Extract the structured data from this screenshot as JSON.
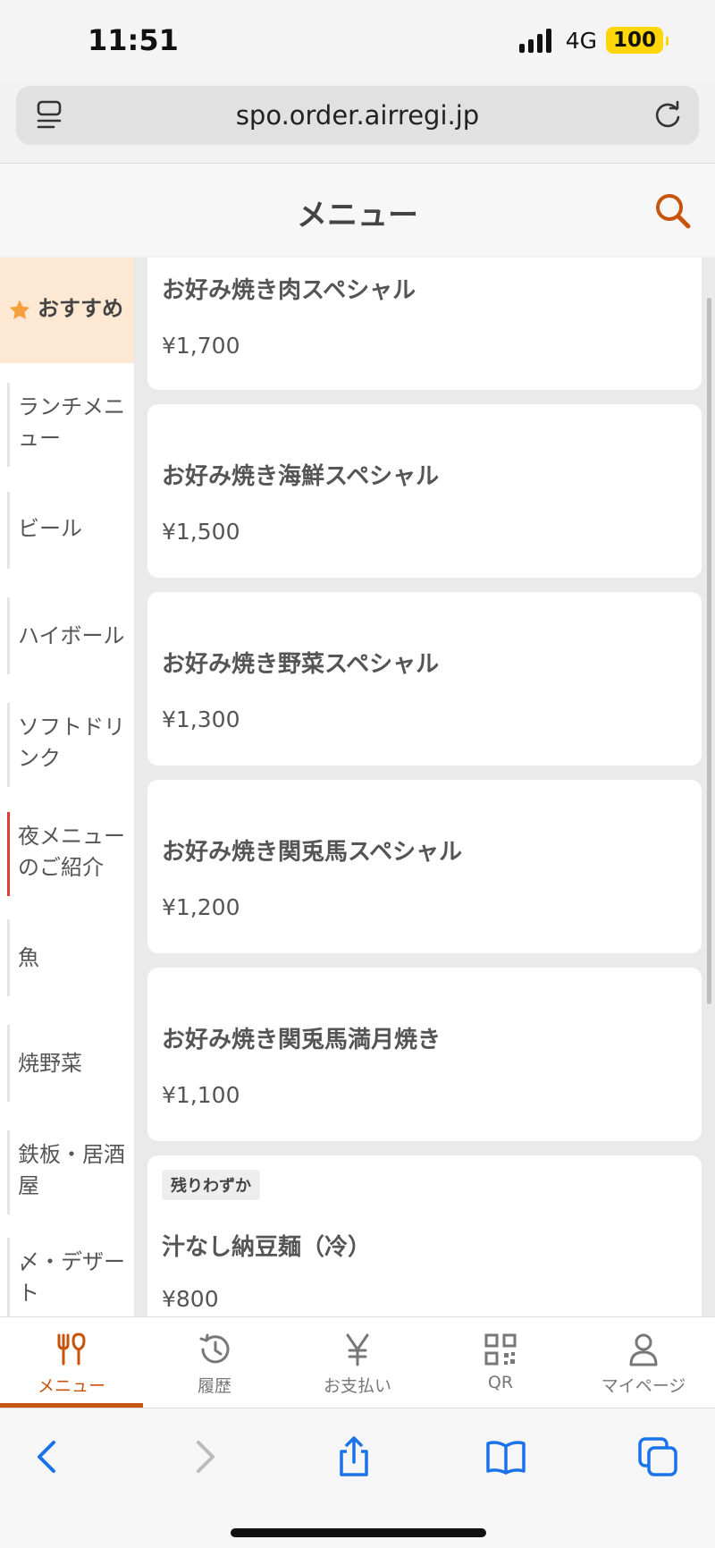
{
  "status_bar": {
    "time": "11:51",
    "network": "4G",
    "battery": "100"
  },
  "browser": {
    "url": "spo.order.airregi.jp"
  },
  "header": {
    "title": "メニュー"
  },
  "sidebar": {
    "items": [
      {
        "label": "おすすめ"
      },
      {
        "label": "ランチメニュー"
      },
      {
        "label": "ビール"
      },
      {
        "label": "ハイボール"
      },
      {
        "label": "ソフトドリンク"
      },
      {
        "label": "夜メニューのご紹介"
      },
      {
        "label": "魚"
      },
      {
        "label": "焼野菜"
      },
      {
        "label": "鉄板・居酒屋"
      },
      {
        "label": "〆・デザート"
      }
    ]
  },
  "menu_items": [
    {
      "name": "お好み焼き肉スペシャル",
      "price": "¥1,700"
    },
    {
      "name": "お好み焼き海鮮スペシャル",
      "price": "¥1,500"
    },
    {
      "name": "お好み焼き野菜スペシャル",
      "price": "¥1,300"
    },
    {
      "name": "お好み焼き関兎馬スペシャル",
      "price": "¥1,200"
    },
    {
      "name": "お好み焼き関兎馬満月焼き",
      "price": "¥1,100"
    },
    {
      "name": "汁なし納豆麺（冷）",
      "price": "¥800",
      "badge": "残りわずか"
    }
  ],
  "bottom_nav": {
    "items": [
      {
        "label": "メニュー"
      },
      {
        "label": "履歴"
      },
      {
        "label": "お支払い"
      },
      {
        "label": "QR"
      },
      {
        "label": "マイページ"
      }
    ]
  },
  "colors": {
    "accent": "#c8530a",
    "active_category_bg": "#fde8d4",
    "safari_blue": "#1a73e8"
  }
}
